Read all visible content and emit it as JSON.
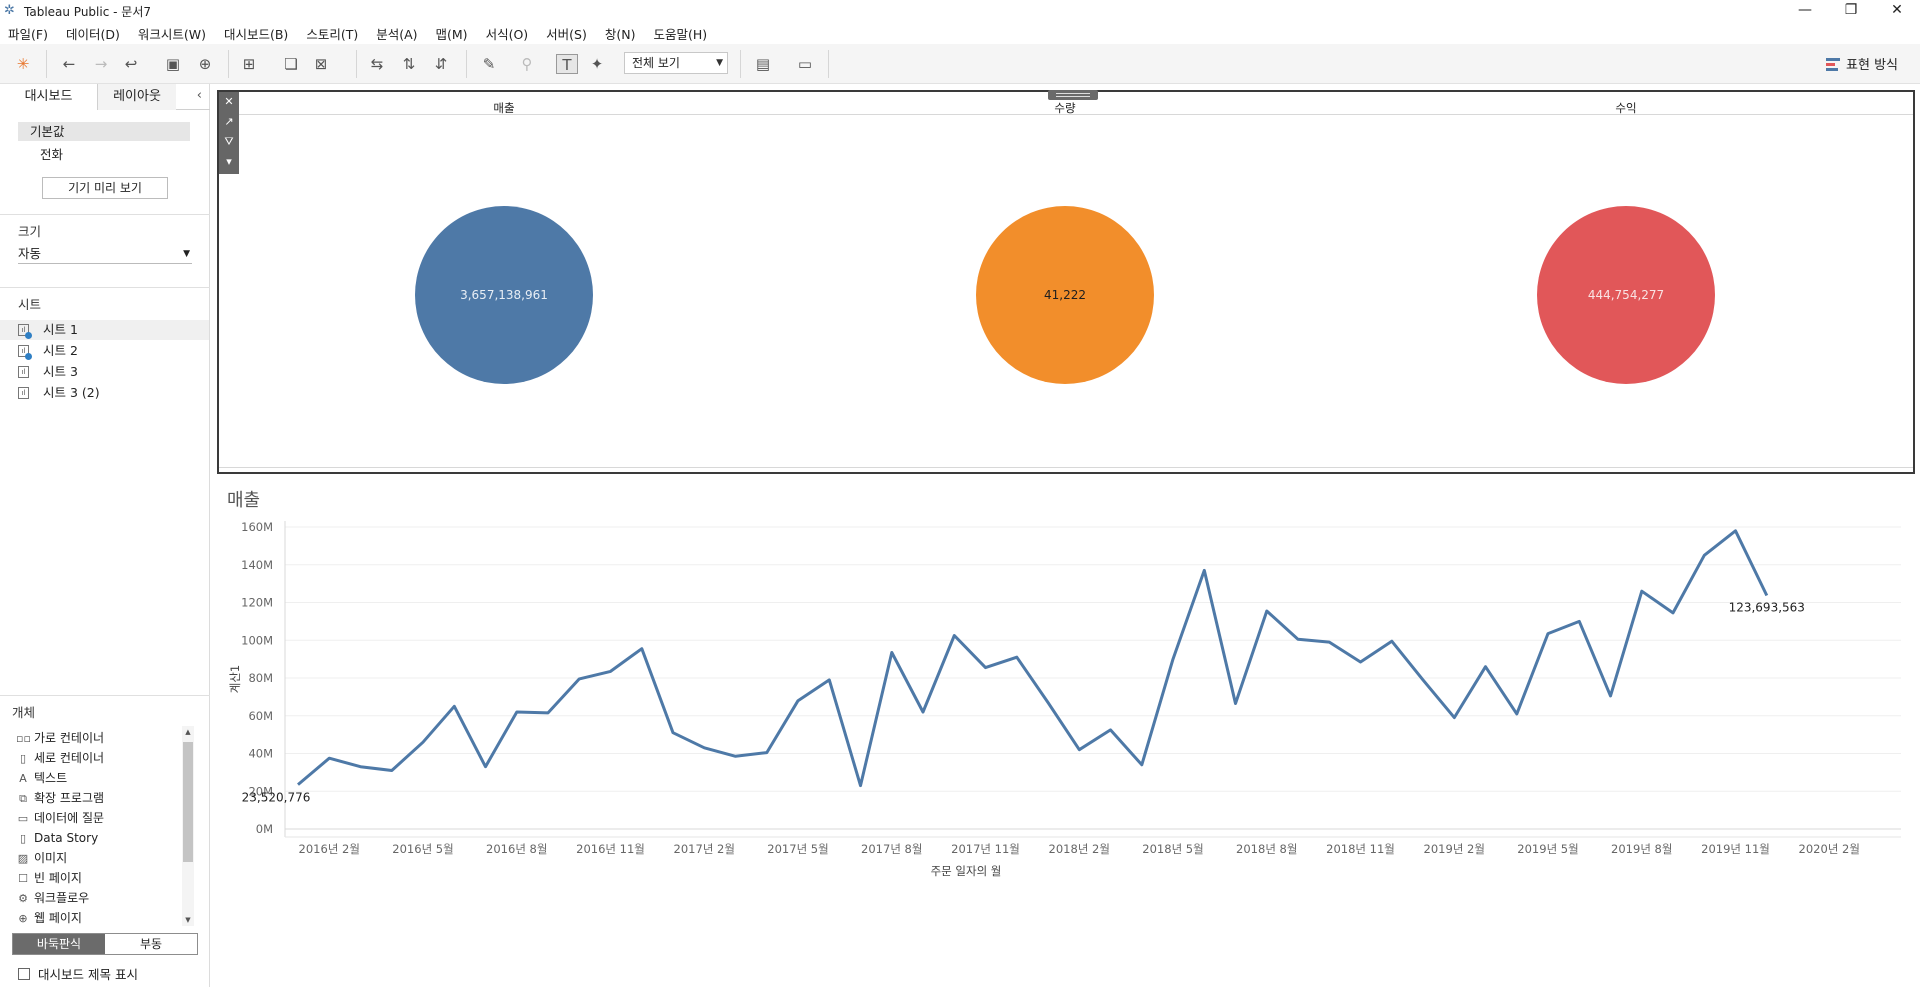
{
  "window": {
    "title": "Tableau Public - 문서7",
    "minimize": "—",
    "restore": "❐",
    "close": "✕"
  },
  "menu": [
    "파일(F)",
    "데이터(D)",
    "워크시트(W)",
    "대시보드(B)",
    "스토리(T)",
    "분석(A)",
    "맵(M)",
    "서식(O)",
    "서버(S)",
    "창(N)",
    "도움말(H)"
  ],
  "toolbar": {
    "fit_label": "전체 보기",
    "show_me_label": "표현 방식"
  },
  "left_panel": {
    "tab_dashboard": "대시보드",
    "tab_layout": "레이아웃",
    "device_default": "기본값",
    "device_phone": "전화",
    "device_preview_button": "기기 미리 보기",
    "size_heading": "크기",
    "size_value": "자동",
    "sheets_heading": "시트",
    "sheets": [
      {
        "label": "시트 1",
        "used": true
      },
      {
        "label": "시트 2",
        "used": true
      },
      {
        "label": "시트 3",
        "used": false
      },
      {
        "label": "시트 3 (2)",
        "used": false
      }
    ],
    "objects_heading": "개체",
    "objects": [
      {
        "label": "가로 컨테이너",
        "icon": "horizontal-container-icon"
      },
      {
        "label": "세로 컨테이너",
        "icon": "vertical-container-icon"
      },
      {
        "label": "텍스트",
        "icon": "text-icon"
      },
      {
        "label": "확장 프로그램",
        "icon": "extension-icon"
      },
      {
        "label": "데이터에 질문",
        "icon": "ask-data-icon"
      },
      {
        "label": "Data Story",
        "icon": "data-story-icon"
      },
      {
        "label": "이미지",
        "icon": "image-icon"
      },
      {
        "label": "빈 페이지",
        "icon": "blank-icon"
      },
      {
        "label": "워크플로우",
        "icon": "workflow-icon"
      },
      {
        "label": "웹 페이지",
        "icon": "web-page-icon"
      }
    ],
    "tiled_label": "바둑판식",
    "floating_label": "부동",
    "show_title_label": "대시보드 제목 표시"
  },
  "kpis": [
    {
      "header": "매출",
      "value": "3,657,138,961",
      "color": "#4e79a7",
      "text_color": "#e8eef5"
    },
    {
      "header": "수량",
      "value": "41,222",
      "color": "#f28e2b",
      "text_color": "#1f1f1f"
    },
    {
      "header": "수익",
      "value": "444,754,277",
      "color": "#e15759",
      "text_color": "#f9e3e3"
    }
  ],
  "chart_title": "매출",
  "chart_data": {
    "type": "line",
    "title": "매출",
    "xlabel": "주문 일자의 월",
    "ylabel": "계산1",
    "ylim": [
      0,
      160000000
    ],
    "y_ticks": [
      "0M",
      "20M",
      "40M",
      "60M",
      "80M",
      "100M",
      "120M",
      "140M",
      "160M"
    ],
    "x_ticks": [
      "2016년 2월",
      "2016년 5월",
      "2016년 8월",
      "2016년 11월",
      "2017년 2월",
      "2017년 5월",
      "2017년 8월",
      "2017년 11월",
      "2018년 2월",
      "2018년 5월",
      "2018년 8월",
      "2018년 11월",
      "2019년 2월",
      "2019년 5월",
      "2019년 8월",
      "2019년 11월",
      "2020년 2월"
    ],
    "line_color": "#4e79a7",
    "grid": "horizontal",
    "series": [
      {
        "x": [
          "2016-01",
          "2016-02",
          "2016-03",
          "2016-04",
          "2016-05",
          "2016-06",
          "2016-07",
          "2016-08",
          "2016-09",
          "2016-10",
          "2016-11",
          "2016-12",
          "2017-01",
          "2017-02",
          "2017-03",
          "2017-04",
          "2017-05",
          "2017-06",
          "2017-07",
          "2017-08",
          "2017-09",
          "2017-10",
          "2017-11",
          "2017-12",
          "2018-01",
          "2018-02",
          "2018-03",
          "2018-04",
          "2018-05",
          "2018-06",
          "2018-07",
          "2018-08",
          "2018-09",
          "2018-10",
          "2018-11",
          "2018-12",
          "2019-01",
          "2019-02",
          "2019-03",
          "2019-04",
          "2019-05",
          "2019-06",
          "2019-07",
          "2019-08",
          "2019-09",
          "2019-10",
          "2019-11",
          "2019-12"
        ],
        "values": [
          23520776,
          37500000,
          33000000,
          31000000,
          46000000,
          65000000,
          33000000,
          62000000,
          61500000,
          79500000,
          83500000,
          95500000,
          51000000,
          43000000,
          38500000,
          40500000,
          68000000,
          79000000,
          23000000,
          93500000,
          62000000,
          102500000,
          85500000,
          91000000,
          67000000,
          42000000,
          52500000,
          34000000,
          90000000,
          137000000,
          66500000,
          115500000,
          100500000,
          99000000,
          88500000,
          99500000,
          79000000,
          59000000,
          86000000,
          61000000,
          103500000,
          110000000,
          70500000,
          126000000,
          114500000,
          145000000,
          158000000,
          123693563
        ]
      }
    ],
    "annotations": [
      {
        "x": "2016-01",
        "label": "23,520,776"
      },
      {
        "x": "2019-12",
        "label": "123,693,563"
      }
    ]
  }
}
